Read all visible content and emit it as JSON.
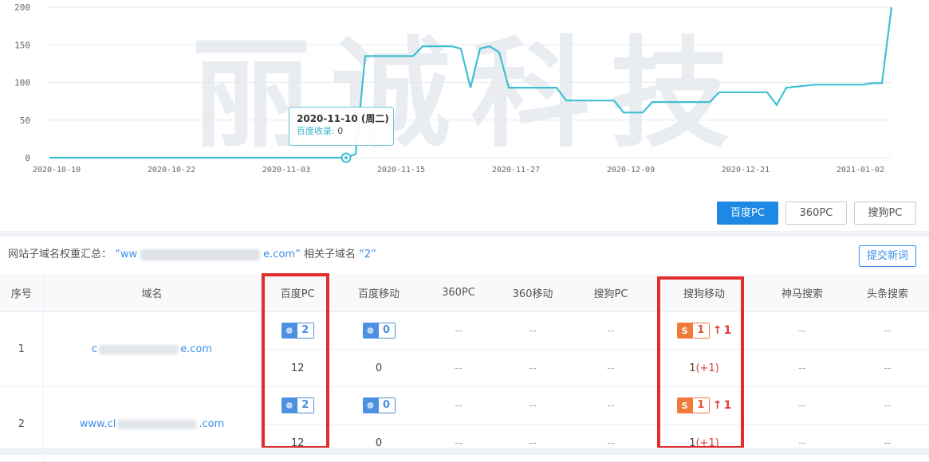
{
  "chart_data": {
    "type": "line",
    "x_ticks": [
      "2020-10-10",
      "2020-10-22",
      "2020-11-03",
      "2020-11-15",
      "2020-11-27",
      "2020-12-09",
      "2020-12-21",
      "2021-01-02"
    ],
    "y_ticks": [
      "0",
      "50",
      "100",
      "150",
      "200"
    ],
    "ylim": [
      0,
      200
    ],
    "xlim": [
      "2020-10-10",
      "2021-01-06"
    ],
    "grid": "horizontal",
    "color": "#3fc0d2",
    "series": [
      {
        "points": [
          [
            "2020-10-10",
            0
          ],
          [
            "2020-11-09",
            0
          ],
          [
            "2020-11-10",
            0
          ],
          [
            "2020-11-11",
            5
          ],
          [
            "2020-11-12",
            135
          ],
          [
            "2020-11-15",
            135
          ],
          [
            "2020-11-17",
            135
          ],
          [
            "2020-11-18",
            148
          ],
          [
            "2020-11-21",
            148
          ],
          [
            "2020-11-22",
            145
          ],
          [
            "2020-11-23",
            93
          ],
          [
            "2020-11-24",
            145
          ],
          [
            "2020-11-25",
            148
          ],
          [
            "2020-11-26",
            140
          ],
          [
            "2020-11-27",
            93
          ],
          [
            "2020-12-02",
            93
          ],
          [
            "2020-12-03",
            76
          ],
          [
            "2020-12-06",
            76
          ],
          [
            "2020-12-08",
            76
          ],
          [
            "2020-12-09",
            60
          ],
          [
            "2020-12-11",
            60
          ],
          [
            "2020-12-12",
            74
          ],
          [
            "2020-12-18",
            74
          ],
          [
            "2020-12-19",
            87
          ],
          [
            "2020-12-24",
            87
          ],
          [
            "2020-12-25",
            70
          ],
          [
            "2020-12-26",
            93
          ],
          [
            "2020-12-29",
            97
          ],
          [
            "2021-01-03",
            97
          ],
          [
            "2021-01-04",
            99
          ],
          [
            "2021-01-05",
            99
          ],
          [
            "2021-01-06",
            200
          ]
        ]
      }
    ],
    "tooltip": {
      "date": "2020-11-10 (周二)",
      "label": "百度收录",
      "value": "0"
    },
    "watermark": "丽诚科技"
  },
  "engine_tabs": [
    {
      "label": "百度PC",
      "active": true
    },
    {
      "label": "360PC",
      "active": false
    },
    {
      "label": "搜狗PC",
      "active": false
    }
  ],
  "summary": {
    "prefix": "网站子域名权重汇总：",
    "domain_start": "ww",
    "domain_end": "e.com",
    "middle": "相关子域名",
    "count": "2",
    "quote_open": "“",
    "quote_close": "”"
  },
  "submit_label": "提交新词",
  "table": {
    "headers": [
      "序号",
      "域名",
      "百度PC",
      "百度移动",
      "360PC",
      "360移动",
      "搜狗PC",
      "搜狗移动",
      "神马搜索",
      "头条搜索"
    ],
    "rows": [
      {
        "index": "1",
        "domain_start": "c",
        "domain_end": "e.com",
        "baidu_pc": {
          "weight": "2",
          "rank": "12"
        },
        "baidu_mobile": {
          "weight": "0",
          "rank": "0"
        },
        "so360_pc": {
          "weight": "--",
          "rank": "--"
        },
        "so360_mobile": {
          "weight": "--",
          "rank": "--"
        },
        "sogou_pc": {
          "weight": "--",
          "rank": "--"
        },
        "sogou_mobile": {
          "weight": "1",
          "rise": "1",
          "rank": "1",
          "delta": "(+1)"
        },
        "shenma": {
          "weight": "--",
          "rank": "--"
        },
        "toutiao": {
          "weight": "--",
          "rank": "--"
        }
      },
      {
        "index": "2",
        "domain_start": "www.cl",
        "domain_end": ".com",
        "baidu_pc": {
          "weight": "2",
          "rank": "12"
        },
        "baidu_mobile": {
          "weight": "0",
          "rank": "0"
        },
        "so360_pc": {
          "weight": "--",
          "rank": "--"
        },
        "so360_mobile": {
          "weight": "--",
          "rank": "--"
        },
        "sogou_pc": {
          "weight": "--",
          "rank": "--"
        },
        "sogou_mobile": {
          "weight": "1",
          "rise": "1",
          "rank": "1",
          "delta": "(+1)"
        },
        "shenma": {
          "weight": "--",
          "rank": "--"
        },
        "toutiao": {
          "weight": "--",
          "rank": "--"
        }
      }
    ]
  },
  "icons": {
    "baidu": "baidu-paw-icon",
    "sogou": "sogou-s-icon",
    "rise": "arrow-up-icon"
  },
  "colors": {
    "accent": "#1e88e5",
    "line": "#3fc0d2",
    "highlight": "#e12d2d",
    "baidu_badge": "#4d8fe0",
    "sogou_badge": "#ef7a3b",
    "rise": "#e03b3b"
  }
}
